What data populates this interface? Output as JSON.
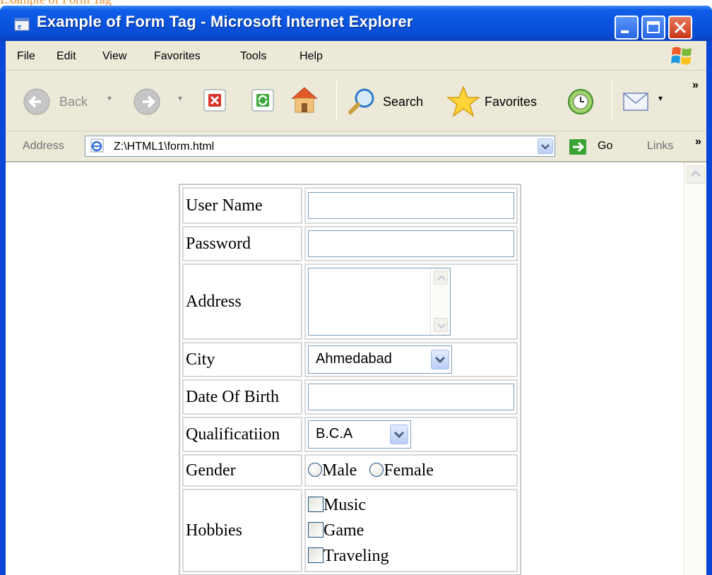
{
  "page_header_fragment": "Example of Form Tag",
  "window": {
    "title": "Example of Form Tag - Microsoft Internet Explorer"
  },
  "menu": [
    "File",
    "Edit",
    "View",
    "Favorites",
    "Tools",
    "Help"
  ],
  "toolbar": {
    "back": "Back",
    "search": "Search",
    "favorites": "Favorites",
    "overflow": "»"
  },
  "address_bar": {
    "label": "Address",
    "url": "Z:\\HTML1\\form.html",
    "go": "Go",
    "links": "Links",
    "links_overflow": "»"
  },
  "form": {
    "user_name_label": "User Name",
    "password_label": "Password",
    "address_label": "Address",
    "city_label": "City",
    "city_value": "Ahmedabad",
    "dob_label": "Date Of Birth",
    "qualification_label": "Qualificatiion",
    "qualification_value": "B.C.A",
    "gender_label": "Gender",
    "gender_options": [
      "Male",
      "Female"
    ],
    "hobbies_label": "Hobbies",
    "hobbies": [
      "Music",
      "Game",
      "Traveling"
    ]
  },
  "colors": {
    "titlebar_blue": "#0a54de",
    "chrome": "#ece9d8",
    "close_red": "#c9381a",
    "header_fragment_orange": "#e8902a"
  }
}
